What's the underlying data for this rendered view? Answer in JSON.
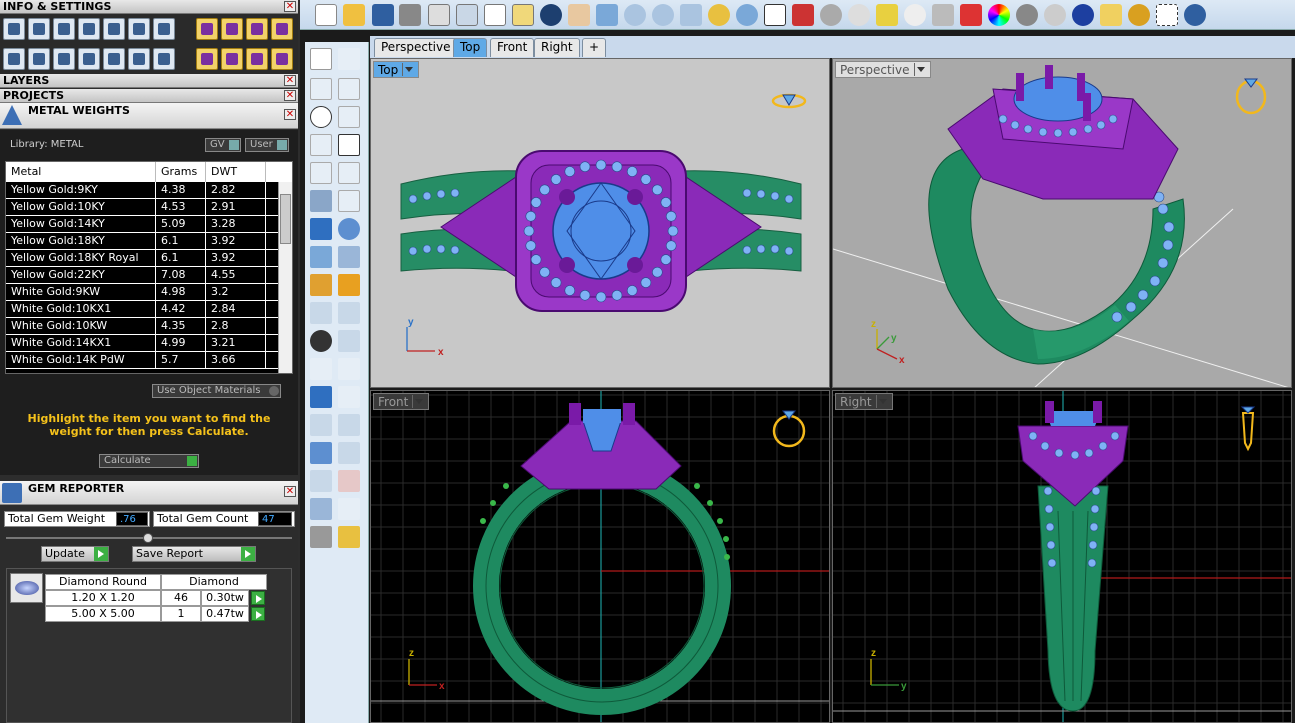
{
  "panels": {
    "info_settings": "INFO & SETTINGS",
    "layers": "LAYERS",
    "projects": "PROJECTS",
    "close_glyph": "✕"
  },
  "metal_weights": {
    "title": "METAL WEIGHTS",
    "library_label": "Library: METAL",
    "gv_label": "GV",
    "user_label": "User",
    "columns": [
      "Metal",
      "Grams",
      "DWT"
    ],
    "rows": [
      [
        "Yellow Gold:9KY",
        "4.38",
        "2.82"
      ],
      [
        "Yellow Gold:10KY",
        "4.53",
        "2.91"
      ],
      [
        "Yellow Gold:14KY",
        "5.09",
        "3.28"
      ],
      [
        "Yellow Gold:18KY",
        "6.1",
        "3.92"
      ],
      [
        "Yellow Gold:18KY Royal",
        "6.1",
        "3.92"
      ],
      [
        "Yellow Gold:22KY",
        "7.08",
        "4.55"
      ],
      [
        "White Gold:9KW",
        "4.98",
        "3.2"
      ],
      [
        "White Gold:10KX1",
        "4.42",
        "2.84"
      ],
      [
        "White Gold:10KW",
        "4.35",
        "2.8"
      ],
      [
        "White Gold:14KX1",
        "4.99",
        "3.21"
      ],
      [
        "White Gold:14K PdW",
        "5.7",
        "3.66"
      ]
    ],
    "use_object_materials": "Use Object Materials",
    "hint": "Highlight the item you want to find the weight for then press Calculate.",
    "calculate_label": "Calculate"
  },
  "gem_reporter": {
    "title": "GEM REPORTER",
    "total_weight_label": "Total Gem Weight",
    "total_weight_value": ".76",
    "total_count_label": "Total Gem Count",
    "total_count_value": "47",
    "update_label": "Update",
    "save_report_label": "Save Report",
    "col_shape": "Diamond Round",
    "col_type": "Diamond",
    "gems": [
      {
        "size": "1.20 X 1.20",
        "count": "46",
        "weight": "0.30tw"
      },
      {
        "size": "5.00 X 5.00",
        "count": "1",
        "weight": "0.47tw"
      }
    ]
  },
  "tabs": [
    "Perspective",
    "Top",
    "Front",
    "Right",
    "+"
  ],
  "active_tab": "Top",
  "viewports": {
    "top": "Top",
    "perspective": "Perspective",
    "front": "Front",
    "right": "Right"
  },
  "axes": {
    "top": [
      "y",
      "x"
    ],
    "perspective": [
      "z",
      "y",
      "x"
    ],
    "front": [
      "z",
      "x"
    ],
    "right": [
      "z",
      "y"
    ]
  },
  "colors": {
    "metal_purple": "#8a2ab8",
    "band_green": "#1e8a60",
    "gem_blue": "#4f8ee8",
    "gold_accent": "#f2b81c"
  }
}
